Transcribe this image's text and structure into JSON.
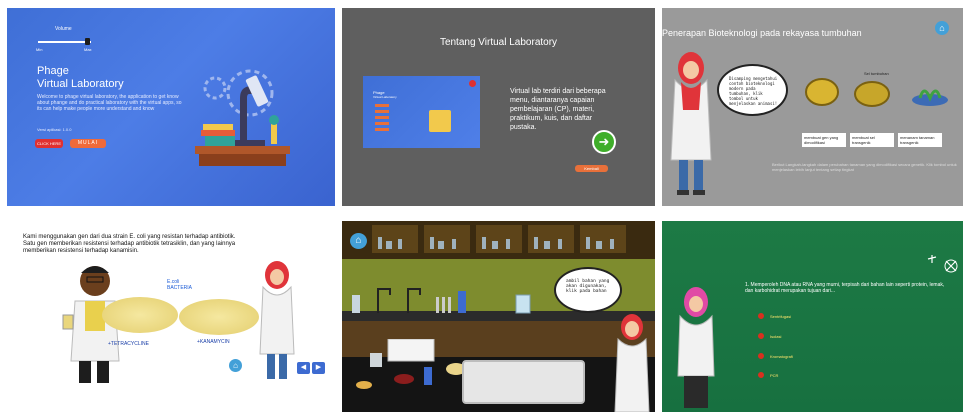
{
  "panel1": {
    "volume_label": "Volume",
    "min_label": "Min",
    "max_label": "Max",
    "title_line1": "Phage",
    "title_line2": "Virtual Laboratory",
    "description": "Welcome to phage virtual laboratory, the application to get know about phange and do practical laboratory with the virtual apps, so its can help make people more understand and know",
    "version": "Versi aplikasi: 1.0.0",
    "click_button": "CLICK HERE",
    "start_button": "MULAI"
  },
  "panel2": {
    "title": "Tentang Virtual Laboratory",
    "description": "Virtual lab terdiri dari beberapa menu, diantaranya capaian pembelajaran (CP), materi, praktikum, kuis, dan daftar pustaka.",
    "thumb_title": "Phage",
    "thumb_subtitle": "Virtual Laboratory",
    "next_icon": "arrow-right-icon",
    "back_button": "Kembali"
  },
  "panel3": {
    "title": "Penerapan Bioteknologi pada rekayasa tumbuhan",
    "bubble_text": "Disamping mengetahui contoh bioteknologi modern pada tumbuhan, klik tombol untuk menjelaskan animasi!",
    "step1": "membuat gen yang dimodifikasi",
    "step2": "membuat sel transgenik",
    "step3": "menanam tanaman transgenik",
    "cell_label": "Sel tumbuhan",
    "footer": "Berikut Langkah-langkah dalam perubahan tanaman yang dimodifikasi secara genetik. Klik tombol untuk menjelaskan lebih lanjut tentang setiap tingkat",
    "home_icon": "home-icon"
  },
  "panel4": {
    "intro": "Kami menggunakan gen dari dua strain E. coli yang resistan terhadap antibiotik. Satu gen memberikan resistensi terhadap antibiotik tetrasiklin, dan yang lainnya memberikan resistensi terhadap kanamisin.",
    "ecoli_label": "E.coli BACTERIA",
    "label_tet": "+TETRACYCLINE",
    "label_kan": "+KANAMYCIN",
    "prev_icon": "prev-icon",
    "next_icon": "next-icon"
  },
  "panel5": {
    "bubble_text": "ambil bahan yang akan digunakan, klik pada bahan",
    "home_icon": "home-icon"
  },
  "panel6": {
    "question": "1. Memperoleh DNA atau RNA yang murni, terpisah dari bahan lain seperti protein, lemak, dan karbohidrat merupakan tujuan dari...",
    "options": [
      "Sentrifugasi",
      "Isolasi",
      "Kromatografi",
      "PCR"
    ]
  }
}
